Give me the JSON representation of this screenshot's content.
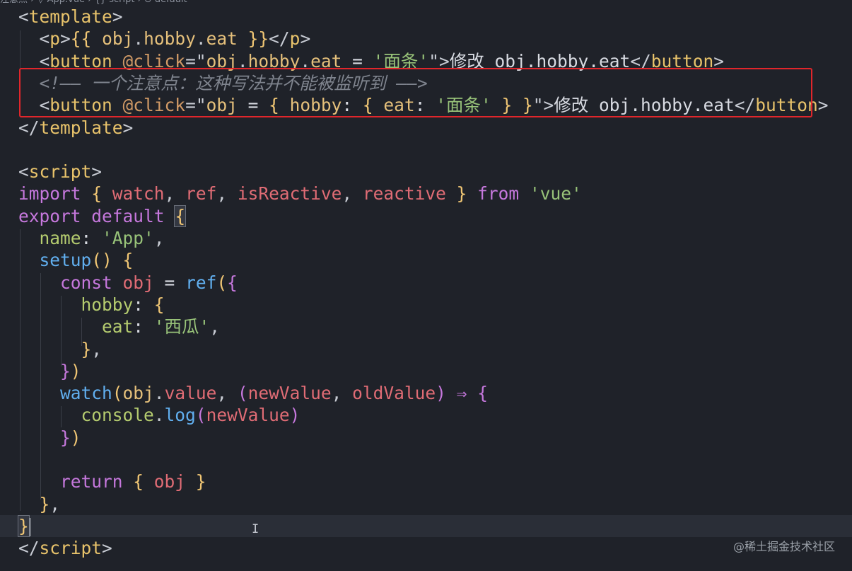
{
  "breadcrumb": {
    "text": "注意点 › ▽ App.vue › {} script › ⊙ default"
  },
  "watermark": "@稀土掘金技术社区",
  "cursor_glyph": "I",
  "lines": [
    {
      "tokens": [
        {
          "t": "<",
          "c": "t-punct"
        },
        {
          "t": "template",
          "c": "t-tagname"
        },
        {
          "t": ">",
          "c": "t-punct"
        }
      ]
    },
    {
      "tokens": [
        {
          "t": "  <",
          "c": "t-punct"
        },
        {
          "t": "p",
          "c": "t-tagname"
        },
        {
          "t": ">",
          "c": "t-punct"
        },
        {
          "t": "{{ ",
          "c": "t-brace"
        },
        {
          "t": "obj",
          "c": "t-yellow"
        },
        {
          "t": ".",
          "c": "t-punct"
        },
        {
          "t": "hobby",
          "c": "t-yellow"
        },
        {
          "t": ".",
          "c": "t-punct"
        },
        {
          "t": "eat",
          "c": "t-yellow"
        },
        {
          "t": " }}",
          "c": "t-brace"
        },
        {
          "t": "</",
          "c": "t-punct"
        },
        {
          "t": "p",
          "c": "t-tagname"
        },
        {
          "t": ">",
          "c": "t-punct"
        }
      ]
    },
    {
      "tokens": [
        {
          "t": "  <",
          "c": "t-punct"
        },
        {
          "t": "button",
          "c": "t-tagname"
        },
        {
          "t": " ",
          "c": "t-text"
        },
        {
          "t": "@click",
          "c": "t-orange"
        },
        {
          "t": "=\"",
          "c": "t-punct"
        },
        {
          "t": "obj",
          "c": "t-yellow"
        },
        {
          "t": ".",
          "c": "t-punct"
        },
        {
          "t": "hobby",
          "c": "t-yellow"
        },
        {
          "t": ".",
          "c": "t-punct"
        },
        {
          "t": "eat",
          "c": "t-yellow"
        },
        {
          "t": " = ",
          "c": "t-text"
        },
        {
          "t": "'面条'",
          "c": "t-str"
        },
        {
          "t": "\">",
          "c": "t-punct"
        },
        {
          "t": "修改 obj.hobby.eat",
          "c": "t-text"
        },
        {
          "t": "</",
          "c": "t-punct"
        },
        {
          "t": "button",
          "c": "t-tagname"
        },
        {
          "t": ">",
          "c": "t-punct"
        }
      ]
    },
    {
      "tokens": [
        {
          "t": "  <!—— 一个注意点：这种写法并不能被监听到 ——>",
          "c": "t-comment"
        }
      ]
    },
    {
      "tokens": [
        {
          "t": "  <",
          "c": "t-punct"
        },
        {
          "t": "button",
          "c": "t-tagname"
        },
        {
          "t": " ",
          "c": "t-text"
        },
        {
          "t": "@click",
          "c": "t-orange"
        },
        {
          "t": "=\"",
          "c": "t-punct"
        },
        {
          "t": "obj",
          "c": "t-yellow"
        },
        {
          "t": " = ",
          "c": "t-text"
        },
        {
          "t": "{ ",
          "c": "t-brace"
        },
        {
          "t": "hobby",
          "c": "t-yellow"
        },
        {
          "t": ": ",
          "c": "t-text"
        },
        {
          "t": "{ ",
          "c": "t-brace"
        },
        {
          "t": "eat",
          "c": "t-yellow"
        },
        {
          "t": ": ",
          "c": "t-text"
        },
        {
          "t": "'面条'",
          "c": "t-str"
        },
        {
          "t": " } }",
          "c": "t-brace"
        },
        {
          "t": "\">",
          "c": "t-punct"
        },
        {
          "t": "修改 obj.hobby.eat",
          "c": "t-text"
        },
        {
          "t": "</",
          "c": "t-punct"
        },
        {
          "t": "button",
          "c": "t-tagname"
        },
        {
          "t": ">",
          "c": "t-punct"
        }
      ]
    },
    {
      "tokens": [
        {
          "t": "</",
          "c": "t-punct"
        },
        {
          "t": "template",
          "c": "t-tagname"
        },
        {
          "t": ">",
          "c": "t-punct"
        }
      ]
    },
    {
      "tokens": []
    },
    {
      "tokens": [
        {
          "t": "<",
          "c": "t-punct"
        },
        {
          "t": "script",
          "c": "t-tagname"
        },
        {
          "t": ">",
          "c": "t-punct"
        }
      ]
    },
    {
      "tokens": [
        {
          "t": "import",
          "c": "t-kw"
        },
        {
          "t": " { ",
          "c": "t-brace"
        },
        {
          "t": "watch",
          "c": "t-param"
        },
        {
          "t": ", ",
          "c": "t-punct"
        },
        {
          "t": "ref",
          "c": "t-param"
        },
        {
          "t": ", ",
          "c": "t-punct"
        },
        {
          "t": "isReactive",
          "c": "t-param"
        },
        {
          "t": ", ",
          "c": "t-punct"
        },
        {
          "t": "reactive",
          "c": "t-param"
        },
        {
          "t": " } ",
          "c": "t-brace"
        },
        {
          "t": "from",
          "c": "t-kw"
        },
        {
          "t": " ",
          "c": "t-text"
        },
        {
          "t": "'vue'",
          "c": "t-str"
        }
      ]
    },
    {
      "tokens": [
        {
          "t": "export",
          "c": "t-kw"
        },
        {
          "t": " ",
          "c": "t-text"
        },
        {
          "t": "default",
          "c": "t-kw"
        },
        {
          "t": " ",
          "c": "t-text"
        },
        {
          "t": "{",
          "c": "t-brace",
          "match": true
        }
      ]
    },
    {
      "tokens": [
        {
          "t": "  name",
          "c": "t-green"
        },
        {
          "t": ": ",
          "c": "t-text"
        },
        {
          "t": "'App'",
          "c": "t-str"
        },
        {
          "t": ",",
          "c": "t-punct"
        }
      ]
    },
    {
      "tokens": [
        {
          "t": "  setup",
          "c": "t-blue"
        },
        {
          "t": "() ",
          "c": "t-brace"
        },
        {
          "t": "{",
          "c": "t-brace"
        }
      ]
    },
    {
      "tokens": [
        {
          "t": "    const",
          "c": "t-kw"
        },
        {
          "t": " ",
          "c": "t-text"
        },
        {
          "t": "obj",
          "c": "t-param"
        },
        {
          "t": " = ",
          "c": "t-text"
        },
        {
          "t": "ref",
          "c": "t-blue"
        },
        {
          "t": "(",
          "c": "t-brace"
        },
        {
          "t": "{",
          "c": "t-kw"
        }
      ]
    },
    {
      "tokens": [
        {
          "t": "      hobby",
          "c": "t-green"
        },
        {
          "t": ": ",
          "c": "t-text"
        },
        {
          "t": "{",
          "c": "t-brace"
        }
      ]
    },
    {
      "tokens": [
        {
          "t": "        eat",
          "c": "t-green"
        },
        {
          "t": ": ",
          "c": "t-text"
        },
        {
          "t": "'西瓜'",
          "c": "t-str"
        },
        {
          "t": ",",
          "c": "t-punct"
        }
      ]
    },
    {
      "tokens": [
        {
          "t": "      }",
          "c": "t-brace"
        },
        {
          "t": ",",
          "c": "t-punct"
        }
      ]
    },
    {
      "tokens": [
        {
          "t": "    }",
          "c": "t-kw"
        },
        {
          "t": ")",
          "c": "t-brace"
        }
      ]
    },
    {
      "tokens": [
        {
          "t": "    watch",
          "c": "t-blue"
        },
        {
          "t": "(",
          "c": "t-brace"
        },
        {
          "t": "obj",
          "c": "t-yellow"
        },
        {
          "t": ".",
          "c": "t-punct"
        },
        {
          "t": "value",
          "c": "t-param"
        },
        {
          "t": ", ",
          "c": "t-punct"
        },
        {
          "t": "(",
          "c": "t-kw"
        },
        {
          "t": "newValue",
          "c": "t-param"
        },
        {
          "t": ", ",
          "c": "t-punct"
        },
        {
          "t": "oldValue",
          "c": "t-param"
        },
        {
          "t": ") ",
          "c": "t-kw"
        },
        {
          "t": "⇒",
          "c": "t-kw"
        },
        {
          "t": " {",
          "c": "t-kw"
        }
      ]
    },
    {
      "tokens": [
        {
          "t": "      console",
          "c": "t-green"
        },
        {
          "t": ".",
          "c": "t-punct"
        },
        {
          "t": "log",
          "c": "t-blue"
        },
        {
          "t": "(",
          "c": "t-kw"
        },
        {
          "t": "newValue",
          "c": "t-param"
        },
        {
          "t": ")",
          "c": "t-kw"
        }
      ]
    },
    {
      "tokens": [
        {
          "t": "    }",
          "c": "t-kw"
        },
        {
          "t": ")",
          "c": "t-brace"
        }
      ]
    },
    {
      "tokens": []
    },
    {
      "tokens": [
        {
          "t": "    return",
          "c": "t-kw"
        },
        {
          "t": " { ",
          "c": "t-brace"
        },
        {
          "t": "obj",
          "c": "t-param"
        },
        {
          "t": " }",
          "c": "t-brace"
        }
      ]
    },
    {
      "tokens": [
        {
          "t": "  }",
          "c": "t-brace"
        },
        {
          "t": ",",
          "c": "t-punct"
        }
      ]
    },
    {
      "tokens": [
        {
          "t": "}",
          "c": "t-brace",
          "match": true
        }
      ],
      "current": true,
      "caret": true
    },
    {
      "tokens": [
        {
          "t": "</",
          "c": "t-punct"
        },
        {
          "t": "script",
          "c": "t-tagname"
        },
        {
          "t": ">",
          "c": "t-punct"
        }
      ]
    }
  ]
}
